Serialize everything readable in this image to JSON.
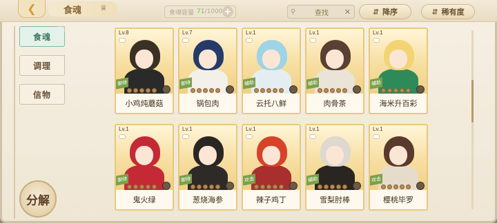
{
  "header": {
    "title": "食魂",
    "capacity_label": "食魂容量",
    "capacity_current": "71",
    "capacity_max": "/1000",
    "search_placeholder": "查找",
    "sort_label": "降序",
    "rarity_label": "稀有度"
  },
  "sidebar": {
    "tabs": [
      {
        "label": "食魂",
        "active": true
      },
      {
        "label": "调理",
        "active": false
      },
      {
        "label": "信物",
        "active": false
      }
    ],
    "decompose_label": "分解"
  },
  "cards": [
    {
      "level": "Lv.8",
      "name": "小鸡炖蘑菇",
      "tag": "御侍",
      "hair": "#3a3024",
      "body": "#2a2a2a"
    },
    {
      "level": "Lv.7",
      "name": "锅包肉",
      "tag": "御侍",
      "hair": "#263a6a",
      "body": "#f3f0ea"
    },
    {
      "level": "Lv.1",
      "name": "云托八鲜",
      "tag": "辅助",
      "hair": "#9fd3e6",
      "body": "#e4eef2"
    },
    {
      "level": "Lv.1",
      "name": "肉骨茶",
      "tag": "辅助",
      "hair": "#5a4032",
      "body": "#e9e3d8"
    },
    {
      "level": "Lv.1",
      "name": "海米升百彩",
      "tag": "辅助",
      "hair": "#f2d472",
      "body": "#2f8a5a"
    },
    {
      "level": "Lv.1",
      "name": "鬼火绿",
      "tag": "御侍",
      "hair": "#c42a35",
      "body": "#c42a35"
    },
    {
      "level": "Lv.1",
      "name": "葱烧海参",
      "tag": "御侍",
      "hair": "#2a2622",
      "body": "#2e2a28"
    },
    {
      "level": "Lv.1",
      "name": "辣子鸡丁",
      "tag": "攻击",
      "hair": "#d6432a",
      "body": "#a92e2e"
    },
    {
      "level": "Lv.1",
      "name": "雪梨肘棒",
      "tag": "辅助",
      "hair": "#ded8d0",
      "body": "#2a2520"
    },
    {
      "level": "Lv.1",
      "name": "樱桃毕罗",
      "tag": "攻击",
      "hair": "#5a3a2c",
      "body": "#e6dccb"
    }
  ],
  "colors": {
    "accent_gold": "#e9c879",
    "active_tab": "#7fb8a3",
    "capacity_current": "#7fbf4a"
  }
}
